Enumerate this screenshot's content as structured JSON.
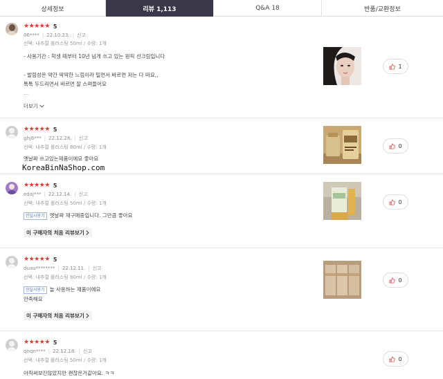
{
  "tabs": [
    {
      "label": "상세정보"
    },
    {
      "label": "리뷰 1,113"
    },
    {
      "label": "Q&A 18"
    },
    {
      "label": "반품/교환정보"
    }
  ],
  "colors": {
    "star": "#e5392f",
    "active_tab": "#3a3848",
    "badge": "#5a79c8"
  },
  "report_label": "신고",
  "star_icon": "★",
  "reviews": [
    {
      "rating": "5",
      "user": "06****",
      "date": "22.10.23.",
      "option": "선택: 내추럴 롤러스팅 50ml / 수량: 1개",
      "lines": [
        "- 사용기간 : 학생 때부터 10년 넘게 쓰고 있는 원픽 선크림입니다",
        "- 발림성은 약간 딱딱한 느낌이라 밀면서 바르면 저는 다 떠요,,",
        "톡톡 두드리면서 바르면 잘 스며들어요",
        "..."
      ],
      "more_label": "더보기",
      "likes": "1"
    },
    {
      "rating": "5",
      "user": "ghj6***",
      "date": "22.12.28.",
      "option": "선택: 내추럴 롤러스팅 80ml / 수량: 1개",
      "lines": [
        "옛날짜 쓰고있는제품이에요 좋아요"
      ],
      "likes": "0"
    },
    {
      "rating": "5",
      "user": "edaj***",
      "date": "22.12.14.",
      "option": "선택: 내추럴 롤러스팅 50ml / 수량: 1개",
      "badge": "한달사용기",
      "lines": [
        "옛날짜 재구매중입니다. 그만큼 좋아요"
      ],
      "first_review_label": "이 구매자의 처음 리뷰보기",
      "likes": "0"
    },
    {
      "rating": "5",
      "user": "duau********",
      "date": "22.12.11.",
      "option": "선택: 내추럴 롤러스팅 80ml / 수량: 1개",
      "badge": "한달사용기",
      "lines": [
        "늘 사용하는 제품이에요",
        "만족해요"
      ],
      "first_review_label": "이 구매자의 처음 리뷰보기",
      "likes": "0"
    },
    {
      "rating": "5",
      "user": "qnqn****",
      "date": "22.12.18.",
      "option": "선택: 내추럴 롤러스팅 50ml / 수량: 1개",
      "lines": [
        "아직써보진않았지만 괜찮은거같아요. ㅋㅋ"
      ],
      "likes": "0"
    }
  ],
  "watermark": "KoreaBinNaShop.com"
}
